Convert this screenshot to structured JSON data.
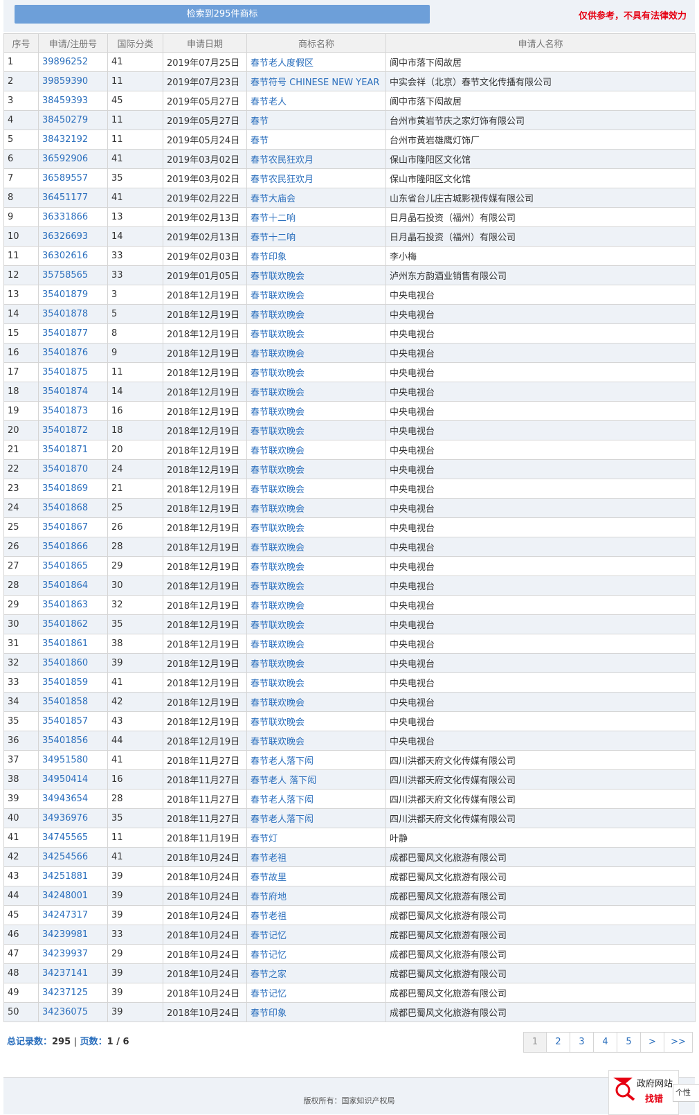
{
  "header": {
    "result_text": "检索到295件商标",
    "disclaimer": "仅供参考，不具有法律效力"
  },
  "columns": [
    "序号",
    "申请/注册号",
    "国际分类",
    "申请日期",
    "商标名称",
    "申请人名称"
  ],
  "rows": [
    [
      "1",
      "39896252",
      "41",
      "2019年07月25日",
      "春节老人度假区",
      "阆中市落下闳故居"
    ],
    [
      "2",
      "39859390",
      "11",
      "2019年07月23日",
      "春节符号 CHINESE NEW YEAR",
      "中实会祥（北京）春节文化传播有限公司"
    ],
    [
      "3",
      "38459393",
      "45",
      "2019年05月27日",
      "春节老人",
      "阆中市落下闳故居"
    ],
    [
      "4",
      "38450279",
      "11",
      "2019年05月27日",
      "春节",
      "台州市黄岩节庆之家灯饰有限公司"
    ],
    [
      "5",
      "38432192",
      "11",
      "2019年05月24日",
      "春节",
      "台州市黄岩雄鹰灯饰厂"
    ],
    [
      "6",
      "36592906",
      "41",
      "2019年03月02日",
      "春节农民狂欢月",
      "保山市隆阳区文化馆"
    ],
    [
      "7",
      "36589557",
      "35",
      "2019年03月02日",
      "春节农民狂欢月",
      "保山市隆阳区文化馆"
    ],
    [
      "8",
      "36451177",
      "41",
      "2019年02月22日",
      "春节大庙会",
      "山东省台儿庄古城影视传媒有限公司"
    ],
    [
      "9",
      "36331866",
      "13",
      "2019年02月13日",
      "春节十二响",
      "日月晶石投资（福州）有限公司"
    ],
    [
      "10",
      "36326693",
      "14",
      "2019年02月13日",
      "春节十二响",
      "日月晶石投资（福州）有限公司"
    ],
    [
      "11",
      "36302616",
      "33",
      "2019年02月03日",
      "春节印象",
      "李小梅"
    ],
    [
      "12",
      "35758565",
      "33",
      "2019年01月05日",
      "春节联欢晚会",
      "泸州东方韵酒业销售有限公司"
    ],
    [
      "13",
      "35401879",
      "3",
      "2018年12月19日",
      "春节联欢晚会",
      "中央电视台"
    ],
    [
      "14",
      "35401878",
      "5",
      "2018年12月19日",
      "春节联欢晚会",
      "中央电视台"
    ],
    [
      "15",
      "35401877",
      "8",
      "2018年12月19日",
      "春节联欢晚会",
      "中央电视台"
    ],
    [
      "16",
      "35401876",
      "9",
      "2018年12月19日",
      "春节联欢晚会",
      "中央电视台"
    ],
    [
      "17",
      "35401875",
      "11",
      "2018年12月19日",
      "春节联欢晚会",
      "中央电视台"
    ],
    [
      "18",
      "35401874",
      "14",
      "2018年12月19日",
      "春节联欢晚会",
      "中央电视台"
    ],
    [
      "19",
      "35401873",
      "16",
      "2018年12月19日",
      "春节联欢晚会",
      "中央电视台"
    ],
    [
      "20",
      "35401872",
      "18",
      "2018年12月19日",
      "春节联欢晚会",
      "中央电视台"
    ],
    [
      "21",
      "35401871",
      "20",
      "2018年12月19日",
      "春节联欢晚会",
      "中央电视台"
    ],
    [
      "22",
      "35401870",
      "24",
      "2018年12月19日",
      "春节联欢晚会",
      "中央电视台"
    ],
    [
      "23",
      "35401869",
      "21",
      "2018年12月19日",
      "春节联欢晚会",
      "中央电视台"
    ],
    [
      "24",
      "35401868",
      "25",
      "2018年12月19日",
      "春节联欢晚会",
      "中央电视台"
    ],
    [
      "25",
      "35401867",
      "26",
      "2018年12月19日",
      "春节联欢晚会",
      "中央电视台"
    ],
    [
      "26",
      "35401866",
      "28",
      "2018年12月19日",
      "春节联欢晚会",
      "中央电视台"
    ],
    [
      "27",
      "35401865",
      "29",
      "2018年12月19日",
      "春节联欢晚会",
      "中央电视台"
    ],
    [
      "28",
      "35401864",
      "30",
      "2018年12月19日",
      "春节联欢晚会",
      "中央电视台"
    ],
    [
      "29",
      "35401863",
      "32",
      "2018年12月19日",
      "春节联欢晚会",
      "中央电视台"
    ],
    [
      "30",
      "35401862",
      "35",
      "2018年12月19日",
      "春节联欢晚会",
      "中央电视台"
    ],
    [
      "31",
      "35401861",
      "38",
      "2018年12月19日",
      "春节联欢晚会",
      "中央电视台"
    ],
    [
      "32",
      "35401860",
      "39",
      "2018年12月19日",
      "春节联欢晚会",
      "中央电视台"
    ],
    [
      "33",
      "35401859",
      "41",
      "2018年12月19日",
      "春节联欢晚会",
      "中央电视台"
    ],
    [
      "34",
      "35401858",
      "42",
      "2018年12月19日",
      "春节联欢晚会",
      "中央电视台"
    ],
    [
      "35",
      "35401857",
      "43",
      "2018年12月19日",
      "春节联欢晚会",
      "中央电视台"
    ],
    [
      "36",
      "35401856",
      "44",
      "2018年12月19日",
      "春节联欢晚会",
      "中央电视台"
    ],
    [
      "37",
      "34951580",
      "41",
      "2018年11月27日",
      "春节老人落下闳",
      "四川洪都天府文化传媒有限公司"
    ],
    [
      "38",
      "34950414",
      "16",
      "2018年11月27日",
      "春节老人 落下闳",
      "四川洪都天府文化传媒有限公司"
    ],
    [
      "39",
      "34943654",
      "28",
      "2018年11月27日",
      "春节老人落下闳",
      "四川洪都天府文化传媒有限公司"
    ],
    [
      "40",
      "34936976",
      "35",
      "2018年11月27日",
      "春节老人落下闳",
      "四川洪都天府文化传媒有限公司"
    ],
    [
      "41",
      "34745565",
      "11",
      "2018年11月19日",
      "春节灯",
      "叶静"
    ],
    [
      "42",
      "34254566",
      "41",
      "2018年10月24日",
      "春节老祖",
      "成都巴蜀风文化旅游有限公司"
    ],
    [
      "43",
      "34251881",
      "39",
      "2018年10月24日",
      "春节故里",
      "成都巴蜀风文化旅游有限公司"
    ],
    [
      "44",
      "34248001",
      "39",
      "2018年10月24日",
      "春节府地",
      "成都巴蜀风文化旅游有限公司"
    ],
    [
      "45",
      "34247317",
      "39",
      "2018年10月24日",
      "春节老祖",
      "成都巴蜀风文化旅游有限公司"
    ],
    [
      "46",
      "34239981",
      "33",
      "2018年10月24日",
      "春节记忆",
      "成都巴蜀风文化旅游有限公司"
    ],
    [
      "47",
      "34239937",
      "29",
      "2018年10月24日",
      "春节记忆",
      "成都巴蜀风文化旅游有限公司"
    ],
    [
      "48",
      "34237141",
      "39",
      "2018年10月24日",
      "春节之家",
      "成都巴蜀风文化旅游有限公司"
    ],
    [
      "49",
      "34237125",
      "39",
      "2018年10月24日",
      "春节记忆",
      "成都巴蜀风文化旅游有限公司"
    ],
    [
      "50",
      "34236075",
      "39",
      "2018年10月24日",
      "春节印象",
      "成都巴蜀风文化旅游有限公司"
    ]
  ],
  "footer": {
    "total_label": "总记录数：",
    "total_value": "295",
    "separator": "|",
    "pages_label": "页数：",
    "pages_value": "1 / 6"
  },
  "pagination": [
    "1",
    "2",
    "3",
    "4",
    "5",
    ">",
    ">>"
  ],
  "current_page": "1",
  "copyright": "版权所有：国家知识产权局",
  "gov_badge": {
    "line1": "政府网站",
    "line2": "找错",
    "icon": "magnifier-icon"
  },
  "personal_tab": "个性",
  "colors": {
    "link": "#2b6fbd",
    "accent": "#6d9fd9",
    "warning": "#e60012",
    "row_alt": "#eef2f7"
  }
}
